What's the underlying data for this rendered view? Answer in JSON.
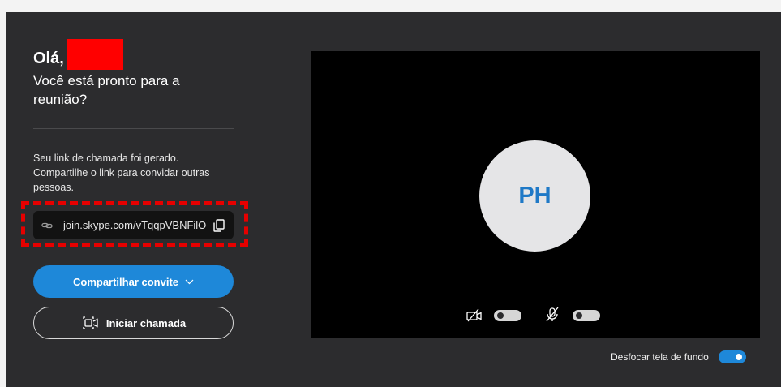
{
  "greeting": {
    "hello": "Olá,"
  },
  "subtitle": "Você está pronto para a reunião?",
  "link_info": "Seu link de chamada foi gerado. Compartilhe o link para convidar outras pessoas.",
  "link": {
    "url": "join.skype.com/vTqqpVBNFilO",
    "icon": "link-icon",
    "copy_icon": "copy-icon"
  },
  "buttons": {
    "share_label": "Compartilhar convite",
    "call_label": "Iniciar chamada"
  },
  "preview": {
    "avatar_initials": "PH",
    "camera_on": false,
    "mic_on": false
  },
  "blur": {
    "label": "Desfocar tela de fundo",
    "on": true
  },
  "colors": {
    "accent": "#1e88d9",
    "panel": "#2c2c2e",
    "highlight": "#e60000"
  }
}
